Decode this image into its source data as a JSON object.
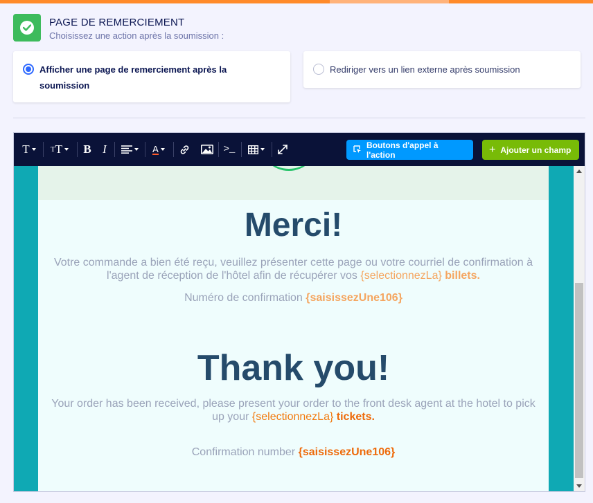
{
  "header": {
    "title": "PAGE DE REMERCIEMENT",
    "subtitle": "Choisissez une action après la soumission :",
    "icon": "check-circle-icon",
    "accent_color": "#3dbb5c"
  },
  "options": [
    {
      "label": "Afficher une page de remerciement après la soumission",
      "selected": true
    },
    {
      "label": "Rediriger vers un lien externe après soumission",
      "selected": false
    }
  ],
  "toolbar": {
    "tools": [
      "text-format-icon",
      "font-size-icon",
      "bold-icon",
      "italic-icon",
      "align-icon",
      "text-color-icon",
      "link-icon",
      "image-icon",
      "code-icon",
      "table-icon",
      "fullscreen-icon"
    ],
    "bold_glyph": "B",
    "italic_glyph": "I",
    "cta_button": "Boutons d'appel à l'action",
    "add_field_button": "Ajouter un champ"
  },
  "content": {
    "merci_heading": "Merci!",
    "fr_text": "Votre commande a bien été reçu, veuillez présenter cette page ou votre courriel de confirmation à l'agent de réception de l'hôtel afin de récupérer vos",
    "fr_placeholder": "{selectionnezLa}",
    "fr_tail": "billets.",
    "fr_conf_label": "Numéro de confirmation",
    "fr_conf_placeholder": "{saisissezUne106}",
    "thanks_heading": "Thank you!",
    "en_text": "Your order has been received, please present your order to the front desk agent at the hotel to pick up your",
    "en_placeholder": "{selectionnezLa}",
    "en_tail": "tickets.",
    "en_conf_label": "Confirmation number",
    "en_conf_placeholder": "{saisissezUne106}"
  },
  "colors": {
    "progress": "#ff8a2a",
    "toolbar_bg": "#0a1238",
    "canvas_bg": "#0fa9b4",
    "heading": "#254b6b",
    "placeholder": "#f27b10"
  }
}
